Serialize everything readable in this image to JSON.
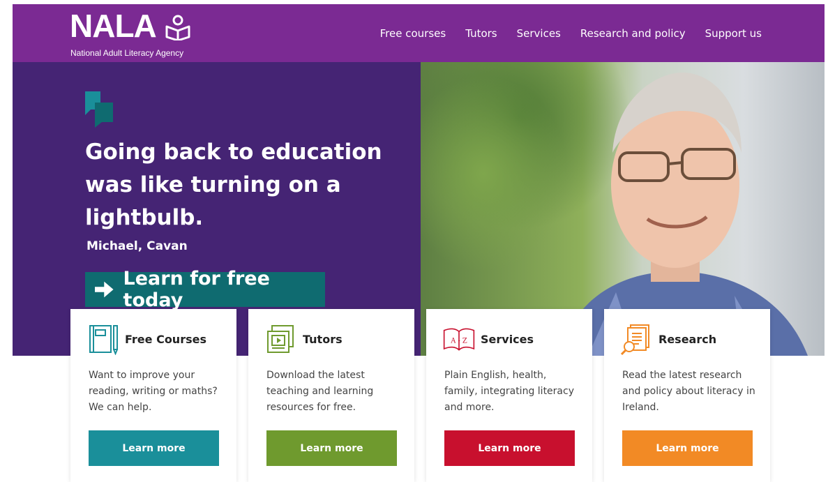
{
  "header": {
    "logo_word": "NALA",
    "logo_subtitle": "National Adult Literacy Agency",
    "nav": [
      "Free courses",
      "Tutors",
      "Services",
      "Research and policy",
      "Support us"
    ]
  },
  "hero": {
    "quote": "Going back to education was like turning on a lightbulb.",
    "attribution": "Michael, Cavan",
    "cta_label": "Learn for free today"
  },
  "cards": [
    {
      "title": "Free Courses",
      "text": "Want to improve your reading, writing or maths? We can help.",
      "button": "Learn more",
      "color": "#1a8f9a",
      "icon": "notebook-icon"
    },
    {
      "title": "Tutors",
      "text": "Download the latest teaching and learning resources for free.",
      "button": "Learn more",
      "color": "#6f9a2e",
      "icon": "video-resources-icon"
    },
    {
      "title": "Services",
      "text": "Plain English, health, family, integrating literacy and more.",
      "button": "Learn more",
      "color": "#c8102e",
      "icon": "az-book-icon"
    },
    {
      "title": "Research",
      "text": "Read the latest research and policy about literacy in Ireland.",
      "button": "Learn more",
      "color": "#f28a25",
      "icon": "document-magnifier-icon"
    }
  ],
  "colors": {
    "header_bg": "#7b2a93",
    "hero_bg": "#452474",
    "cta_bg": "#0f6b70",
    "accent_teal": "#1a8f9a"
  }
}
